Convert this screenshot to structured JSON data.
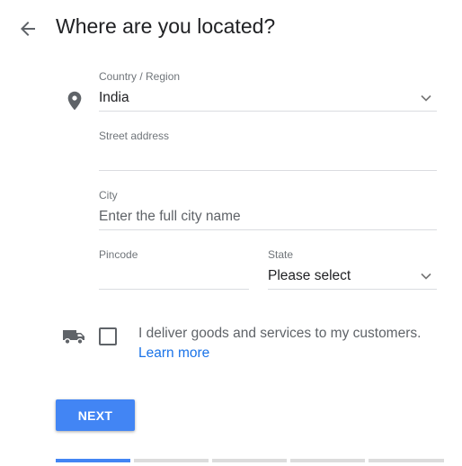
{
  "header": {
    "title": "Where are you located?"
  },
  "form": {
    "country": {
      "label": "Country / Region",
      "value": "India"
    },
    "street": {
      "label": "Street address",
      "value": ""
    },
    "city": {
      "label": "City",
      "placeholder": "Enter the full city name"
    },
    "pincode": {
      "label": "Pincode",
      "value": ""
    },
    "state": {
      "label": "State",
      "value": "Please select"
    }
  },
  "delivery": {
    "checked": false,
    "text": "I deliver goods and services to my customers.",
    "link": "Learn more"
  },
  "actions": {
    "next_label": "NEXT"
  },
  "progress": {
    "total_steps": 5,
    "current_step": 1
  },
  "colors": {
    "accent": "#4285f4",
    "link": "#1a73e8",
    "icon": "#5f6368"
  },
  "icons": {
    "back": "arrow-left-icon",
    "location": "location-pin-icon",
    "delivery": "truck-icon",
    "dropdown": "chevron-down-icon"
  }
}
